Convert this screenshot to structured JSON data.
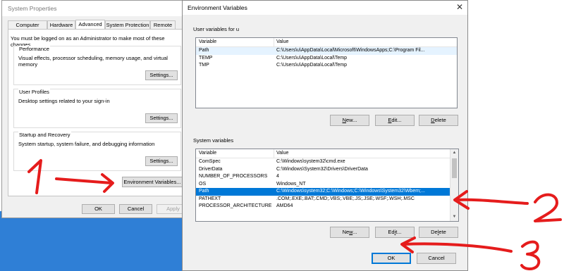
{
  "system_properties": {
    "title": "System Properties",
    "tabs": [
      "Computer Name",
      "Hardware",
      "Advanced",
      "System Protection",
      "Remote"
    ],
    "active_tab": "Advanced",
    "notice": "You must be logged on as an Administrator to make most of these changes.",
    "performance": {
      "title": "Performance",
      "description": "Visual effects, processor scheduling, memory usage, and virtual memory",
      "button": "Settings..."
    },
    "user_profiles": {
      "title": "User Profiles",
      "description": "Desktop settings related to your sign-in",
      "button": "Settings..."
    },
    "startup_recovery": {
      "title": "Startup and Recovery",
      "description": "System startup, system failure, and debugging information",
      "button": "Settings..."
    },
    "env_button": "Environment Variables...",
    "ok": "OK",
    "cancel": "Cancel",
    "apply": "Apply"
  },
  "env": {
    "title": "Environment Variables",
    "close_glyph": "✕",
    "user_section": "User variables for u",
    "system_section": "System variables",
    "col_variable": "Variable",
    "col_value": "Value",
    "user_vars": [
      {
        "name": "Path",
        "value": "C:\\Users\\u\\AppData\\Local\\Microsoft\\WindowsApps;C:\\Program Fil..."
      },
      {
        "name": "TEMP",
        "value": "C:\\Users\\u\\AppData\\Local\\Temp"
      },
      {
        "name": "TMP",
        "value": "C:\\Users\\u\\AppData\\Local\\Temp"
      }
    ],
    "system_vars": [
      {
        "name": "ComSpec",
        "value": "C:\\Windows\\system32\\cmd.exe"
      },
      {
        "name": "DriverData",
        "value": "C:\\Windows\\System32\\Drivers\\DriverData"
      },
      {
        "name": "NUMBER_OF_PROCESSORS",
        "value": "4"
      },
      {
        "name": "OS",
        "value": "Windows_NT"
      },
      {
        "name": "Path",
        "value": "C:\\Windows\\system32;C:\\Windows;C:\\Windows\\System32\\Wbem;..."
      },
      {
        "name": "PATHEXT",
        "value": ".COM;.EXE;.BAT;.CMD;.VBS;.VBE;.JS;.JSE;.WSF;.WSH;.MSC"
      },
      {
        "name": "PROCESSOR_ARCHITECTURE",
        "value": "AMD64"
      }
    ],
    "user_buttons": {
      "new_pre": "",
      "new_u": "N",
      "new_post": "ew...",
      "edit_pre": "",
      "edit_u": "E",
      "edit_post": "dit...",
      "delete_pre": "",
      "delete_u": "D",
      "delete_post": "elete"
    },
    "system_buttons": {
      "new_pre": "Ne",
      "new_u": "w",
      "new_post": "...",
      "edit_pre": "Ed",
      "edit_u": "i",
      "edit_post": "t...",
      "delete_pre": "De",
      "delete_u": "l",
      "delete_post": "ete"
    },
    "ok": "OK",
    "cancel": "Cancel"
  },
  "annotations": {
    "step1": "1",
    "step2": "2",
    "step3": "3",
    "color": "#e51c1c"
  }
}
